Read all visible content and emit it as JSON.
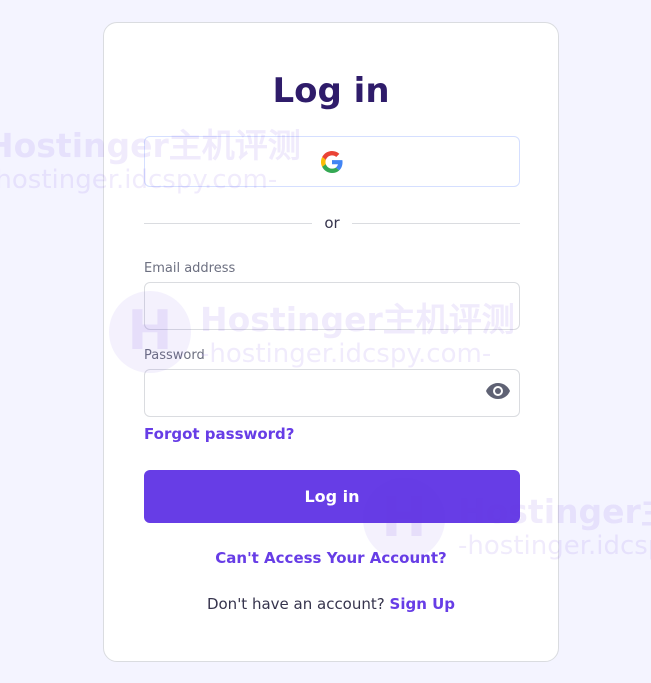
{
  "page": {
    "title": "Log in",
    "accent_color": "#673de6",
    "title_color": "#2f1c6a"
  },
  "google_button": {
    "icon": "google-g-icon"
  },
  "divider": {
    "text": "or"
  },
  "email": {
    "label": "Email address",
    "value": "",
    "placeholder": ""
  },
  "password": {
    "label": "Password",
    "value": "",
    "placeholder": "",
    "toggle_icon": "eye-icon"
  },
  "links": {
    "forgot_password": "Forgot password?",
    "cant_access": "Can't Access Your Account?",
    "no_account_text": "Don't have an account?",
    "sign_up": "Sign Up"
  },
  "buttons": {
    "login_label": "Log in"
  },
  "watermark": {
    "line1": "Hostinger主机评测",
    "line2": "-hostinger.idcspy.com-"
  }
}
